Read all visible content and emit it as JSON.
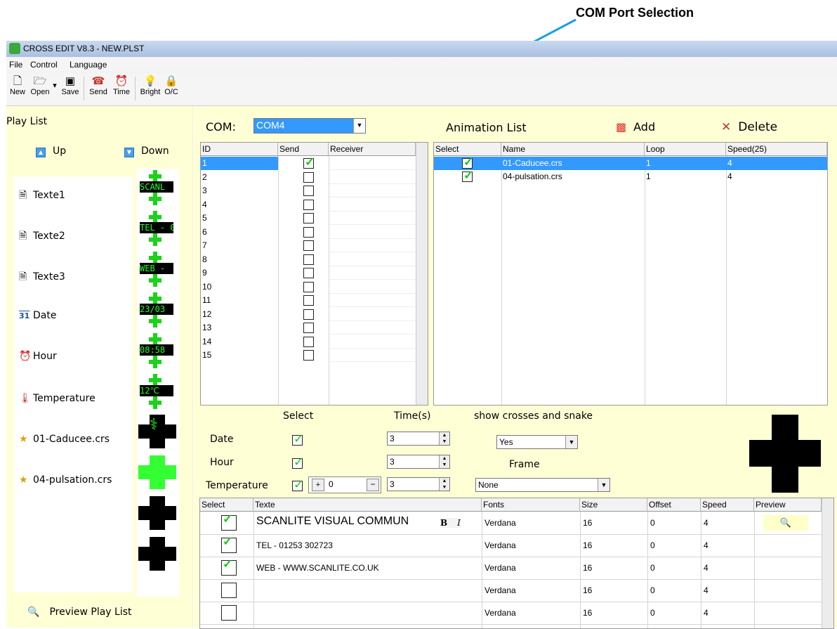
{
  "callout": {
    "text": "COM Port Selection"
  },
  "window": {
    "title": "CROSS EDIT V8.3 - NEW.PLST"
  },
  "menu": [
    "File",
    "Control",
    "Language"
  ],
  "toolbar": {
    "new": "New",
    "open": "Open",
    "save": "Save",
    "send": "Send",
    "time": "Time",
    "bright": "Bright",
    "oc": "O/C"
  },
  "playlist": {
    "title": "Play List",
    "up": "Up",
    "down": "Down",
    "items": [
      "Texte1",
      "Texte2",
      "Texte3",
      "Date",
      "Hour",
      "Temperature",
      "01-Caducee.crs",
      "04-pulsation.crs"
    ],
    "preview": "Preview Play List",
    "date_icon": "31"
  },
  "strip": {
    "led_texts": [
      "SCANL",
      "TEL - 0",
      "WEB -",
      "23/03",
      "08:58",
      "12℃"
    ]
  },
  "com": {
    "label": "COM:",
    "value": "COM4"
  },
  "receivers": {
    "headers": [
      "ID",
      "Send",
      "Receiver"
    ],
    "ids": [
      "1",
      "2",
      "3",
      "4",
      "5",
      "6",
      "7",
      "8",
      "9",
      "10",
      "11",
      "12",
      "13",
      "14",
      "15"
    ],
    "checked": [
      true,
      false,
      false,
      false,
      false,
      false,
      false,
      false,
      false,
      false,
      false,
      false,
      false,
      false,
      false
    ]
  },
  "animation": {
    "title": "Animation List",
    "add": "Add",
    "delete": "Delete",
    "headers": [
      "Select",
      "Name",
      "Loop",
      "Speed(25)"
    ],
    "rows": [
      {
        "name": "01-Caducee.crs",
        "loop": "1",
        "speed": "4"
      },
      {
        "name": "04-pulsation.crs",
        "loop": "1",
        "speed": "4"
      }
    ]
  },
  "settings": {
    "select": "Select",
    "time": "Time(s)",
    "show": "show crosses and snake",
    "date": "Date",
    "hour": "Hour",
    "temperature": "Temperature",
    "date_time": "3",
    "hour_time": "3",
    "temp_time": "3",
    "temp_offset": "0",
    "show_value": "Yes",
    "frame": "Frame",
    "frame_value": "None"
  },
  "texts": {
    "headers": [
      "Select",
      "Texte",
      "Fonts",
      "Size",
      "Offset",
      "Speed",
      "Preview"
    ],
    "bold": "B",
    "italic": "I",
    "rows": [
      {
        "text": "SCANLITE VISUAL COMMUN",
        "font": "Verdana",
        "size": "16",
        "offset": "0",
        "speed": "4"
      },
      {
        "text": "TEL - 01253 302723",
        "font": "Verdana",
        "size": "16",
        "offset": "0",
        "speed": "4"
      },
      {
        "text": "WEB - WWW.SCANLITE.CO.UK",
        "font": "Verdana",
        "size": "16",
        "offset": "0",
        "speed": "4"
      },
      {
        "text": "",
        "font": "Verdana",
        "size": "16",
        "offset": "0",
        "speed": "4"
      },
      {
        "text": "",
        "font": "Verdana",
        "size": "16",
        "offset": "0",
        "speed": "4"
      }
    ]
  },
  "colors": {
    "accent": "#3399ff",
    "panel": "#ffffd6",
    "led": "#22ff22",
    "callout": "#1a9ee8"
  }
}
